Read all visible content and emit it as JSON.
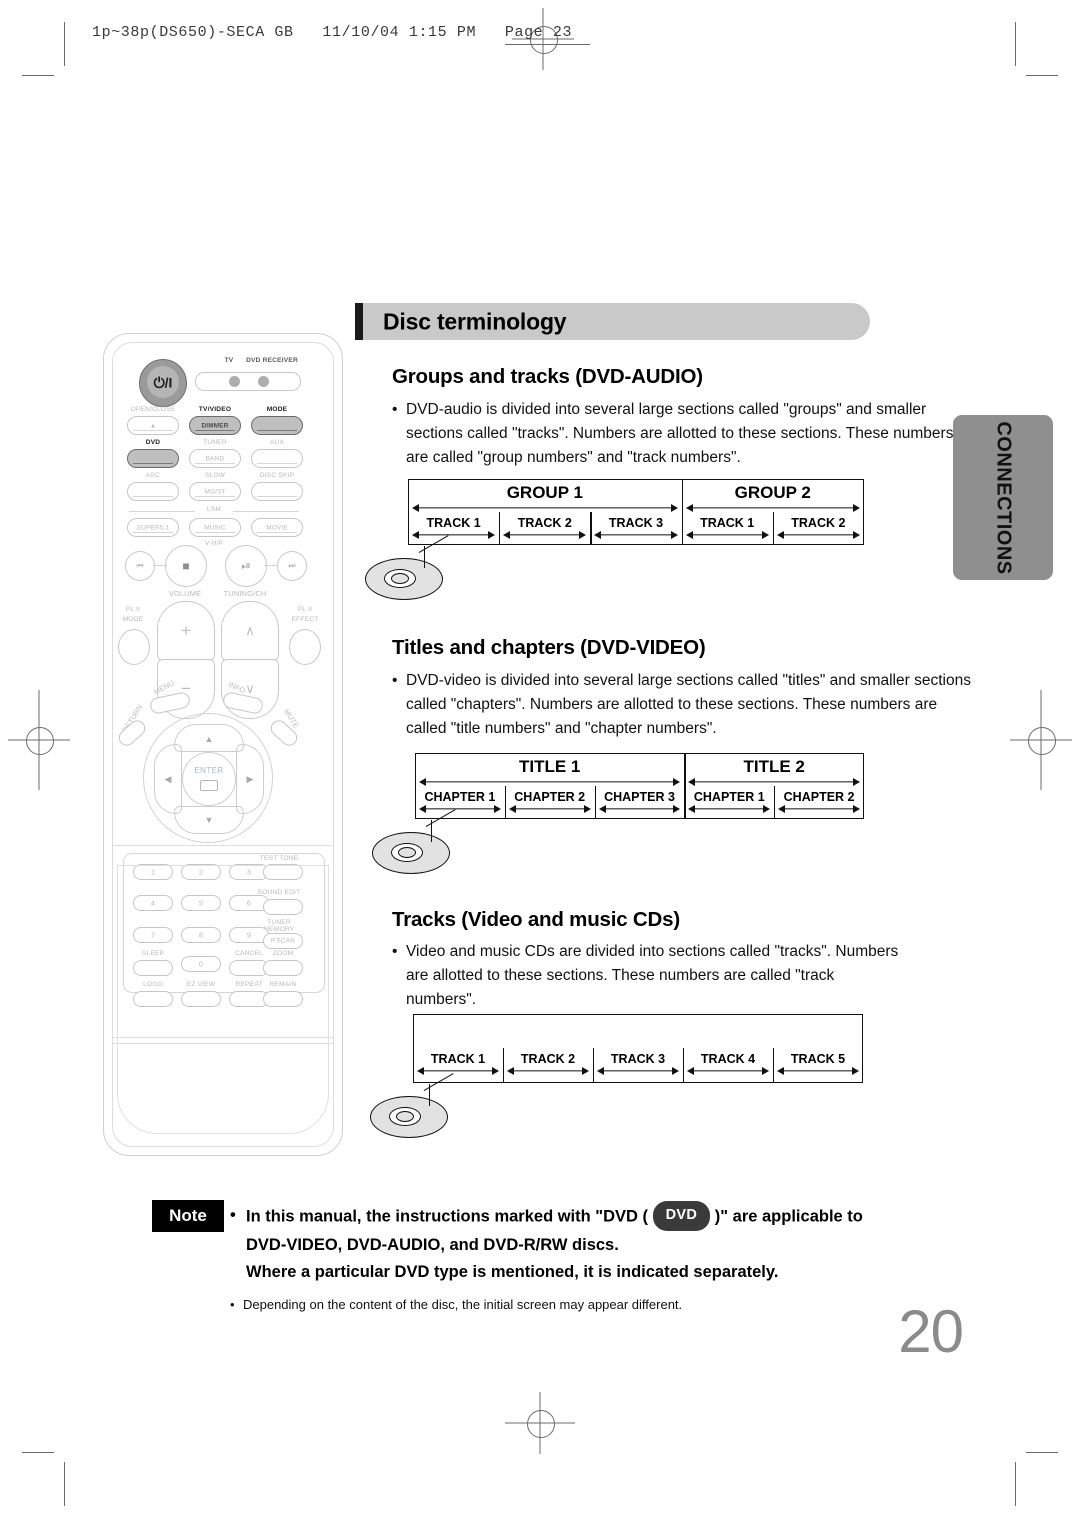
{
  "print_marks": {
    "slug": "1p~38p(DS650)-SECA GB   11/10/04 1:15 PM   Page 23"
  },
  "side_tab": {
    "label": "CONNECTIONS"
  },
  "page_number": "20",
  "banner": {
    "title": "Disc terminology"
  },
  "sections": [
    {
      "heading": "Groups and tracks (DVD-AUDIO)",
      "body": "DVD-audio is divided into several large sections called \"groups\" and smaller sections called \"tracks\". Numbers are allotted to these sections. These numbers are called \"group numbers\" and \"track numbers\"."
    },
    {
      "heading": "Titles and chapters (DVD-VIDEO)",
      "body": "DVD-video is divided into several large sections called \"titles\" and smaller sections called \"chapters\". Numbers are allotted to these sections. These numbers are called \"title numbers\" and \"chapter numbers\"."
    },
    {
      "heading": "Tracks (Video and music CDs)",
      "body": "Video and music CDs are divided into sections called \"tracks\". Numbers are allotted to these sections. These numbers are called \"track numbers\"."
    }
  ],
  "chart_data": [
    {
      "type": "bar",
      "title": "Groups and tracks (DVD-AUDIO)",
      "orientation": "horizontal-segmented-timeline",
      "levels": [
        {
          "name": "groups",
          "segments": [
            {
              "label": "GROUP 1",
              "span": 3
            },
            {
              "label": "GROUP 2",
              "span": 2
            }
          ]
        },
        {
          "name": "tracks",
          "segments": [
            {
              "label": "TRACK 1",
              "span": 1
            },
            {
              "label": "TRACK 2",
              "span": 1
            },
            {
              "label": "TRACK 3",
              "span": 1
            },
            {
              "label": "TRACK 1",
              "span": 1
            },
            {
              "label": "TRACK 2",
              "span": 1
            }
          ]
        }
      ],
      "total_units": 5,
      "group_breaks_after_unit": [
        3
      ]
    },
    {
      "type": "bar",
      "title": "Titles and chapters (DVD-VIDEO)",
      "orientation": "horizontal-segmented-timeline",
      "levels": [
        {
          "name": "titles",
          "segments": [
            {
              "label": "TITLE 1",
              "span": 3
            },
            {
              "label": "TITLE 2",
              "span": 2
            }
          ]
        },
        {
          "name": "chapters",
          "segments": [
            {
              "label": "CHAPTER 1",
              "span": 1
            },
            {
              "label": "CHAPTER 2",
              "span": 1
            },
            {
              "label": "CHAPTER 3",
              "span": 1
            },
            {
              "label": "CHAPTER 1",
              "span": 1
            },
            {
              "label": "CHAPTER 2",
              "span": 1
            }
          ]
        }
      ],
      "total_units": 5,
      "group_breaks_after_unit": [
        3
      ]
    },
    {
      "type": "bar",
      "title": "Tracks (Video and music CDs)",
      "orientation": "horizontal-segmented-timeline",
      "levels": [
        {
          "name": "tracks",
          "segments": [
            {
              "label": "TRACK 1",
              "span": 1
            },
            {
              "label": "TRACK 2",
              "span": 1
            },
            {
              "label": "TRACK 3",
              "span": 1
            },
            {
              "label": "TRACK 4",
              "span": 1
            },
            {
              "label": "TRACK 5",
              "span": 1
            }
          ]
        }
      ],
      "total_units": 5,
      "group_breaks_after_unit": []
    }
  ],
  "note": {
    "badge": "Note",
    "chip": "DVD",
    "line1_a": "In this manual, the instructions marked with \"DVD (",
    "line1_b": ")\" are applicable to",
    "line2": "DVD-VIDEO, DVD-AUDIO, and DVD-R/RW discs.",
    "line3": "Where a particular DVD type is mentioned, it is indicated separately.",
    "sub": "Depending on the content of the disc, the initial screen may appear different."
  },
  "remote": {
    "power_symbol": "⏻/I",
    "indicators": [
      "TV",
      "DVD RECEIVER"
    ],
    "rows": [
      {
        "left": "OPEN/CLOSE",
        "mid": "TV/VIDEO",
        "mid_sub": "DIMMER",
        "right": "MODE"
      },
      {
        "left": "DVD",
        "mid": "TUNER",
        "mid_sub": "BAND",
        "right": "AUX"
      },
      {
        "left": "ASC",
        "mid": "SLOW",
        "mid_sub": "MO/ST",
        "right": "DISC SKIP"
      }
    ],
    "lsm_label": "LSM",
    "lsm_buttons": [
      "SUPER5.1",
      "MUSIC",
      "MOVIE"
    ],
    "vhp_label": "V-H/P",
    "transport": [
      "prev",
      "stop",
      "play-pause",
      "next"
    ],
    "volume_label": "VOLUME",
    "tuning_label": "TUNING/CH",
    "plii_mode": "MODE",
    "plii_mode_top": "PL II",
    "plii_effect": "EFFECT",
    "plii_effect_top": "PL II",
    "menu": "MENU",
    "info": "INFO",
    "return": "RETURN",
    "mute": "MUTE",
    "enter": "ENTER",
    "keypad": [
      "1",
      "2",
      "3",
      "4",
      "5",
      "6",
      "7",
      "8",
      "9",
      "0"
    ],
    "side_keys": [
      "TEST TONE",
      "SOUND EDIT",
      "TUNER",
      "MEMORY",
      "P.SCAN"
    ],
    "bottom_keys": [
      "SLEEP",
      "CANCEL",
      "ZOOM",
      "LOGO",
      "EZ VIEW",
      "REPEAT",
      "REMAIN"
    ]
  },
  "colors": {
    "banner_bg": "#c9c9c9",
    "side_tab_bg": "#8f8f8f",
    "page_number": "#8b8b8b",
    "ink": "#111111"
  }
}
